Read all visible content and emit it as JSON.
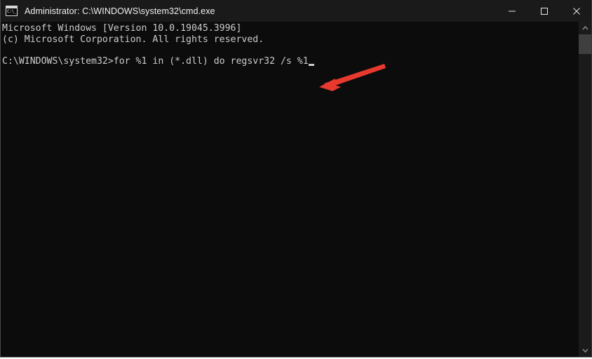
{
  "window": {
    "title": "Administrator: C:\\WINDOWS\\system32\\cmd.exe",
    "icon_name": "cmd-icon",
    "icon_prompt": "C:\\_",
    "background_color": "#0c0c0c",
    "titlebar_color": "#1a1a1a"
  },
  "controls": {
    "minimize_label": "Minimize",
    "maximize_label": "Maximize",
    "close_label": "Close"
  },
  "console": {
    "lines": [
      "Microsoft Windows [Version 10.0.19045.3996]",
      "(c) Microsoft Corporation. All rights reserved.",
      ""
    ],
    "text_block": "Microsoft Windows [Version 10.0.19045.3996]\n(c) Microsoft Corporation. All rights reserved.",
    "prompt": "C:\\WINDOWS\\system32>",
    "command": "for %1 in (*.dll) do regsvr32 /s %1",
    "full_command_line": "C:\\WINDOWS\\system32>for %1 in (*.dll) do regsvr32 /s %1",
    "text_color": "#cccccc"
  },
  "annotation": {
    "type": "arrow",
    "color": "#e8392f",
    "points_to": "command-cursor"
  },
  "scrollbar": {
    "up_arrow": "▲",
    "down_arrow": "▼",
    "thumb_color": "#3f3f3f",
    "track_color": "#1b1b1b"
  }
}
